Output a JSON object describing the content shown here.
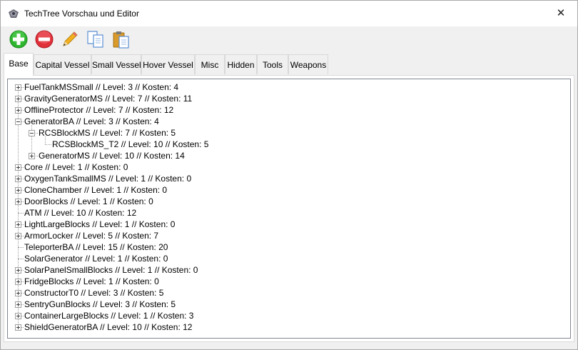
{
  "window": {
    "title": "TechTree Vorschau und Editor",
    "close_glyph": "✕"
  },
  "toolbar": {
    "buttons": [
      {
        "name": "add",
        "icon": "plus-circle-icon",
        "color": "#2db52d"
      },
      {
        "name": "remove",
        "icon": "minus-circle-icon",
        "color": "#e0303a"
      },
      {
        "name": "edit",
        "icon": "pencil-icon",
        "color": "#f2b01e"
      },
      {
        "name": "copy",
        "icon": "copy-icon",
        "color": "#5b8fd6"
      },
      {
        "name": "paste",
        "icon": "paste-icon",
        "color": "#d99a2b"
      }
    ]
  },
  "tabs": [
    {
      "label": "Base",
      "active": true
    },
    {
      "label": "Capital Vessel"
    },
    {
      "label": "Small Vessel"
    },
    {
      "label": "Hover Vessel"
    },
    {
      "label": "Misc"
    },
    {
      "label": "Hidden"
    },
    {
      "label": "Tools"
    },
    {
      "label": "Weapons"
    }
  ],
  "tree": {
    "nodes": [
      {
        "label": "FuelTankMSSmall // Level: 3 // Kosten: 4",
        "depth": 0,
        "expander": "plus"
      },
      {
        "label": "GravityGeneratorMS // Level: 7 // Kosten: 11",
        "depth": 0,
        "expander": "plus"
      },
      {
        "label": "OfflineProtector // Level: 7 // Kosten: 12",
        "depth": 0,
        "expander": "plus"
      },
      {
        "label": "GeneratorBA // Level: 3 // Kosten: 4",
        "depth": 0,
        "expander": "minus"
      },
      {
        "label": "RCSBlockMS // Level: 7 // Kosten: 5",
        "depth": 1,
        "expander": "minus"
      },
      {
        "label": "RCSBlockMS_T2 // Level: 10 // Kosten: 5",
        "depth": 2,
        "expander": "none"
      },
      {
        "label": "GeneratorMS // Level: 10 // Kosten: 14",
        "depth": 1,
        "expander": "plus"
      },
      {
        "label": "Core // Level: 1 // Kosten: 0",
        "depth": 0,
        "expander": "plus"
      },
      {
        "label": "OxygenTankSmallMS // Level: 1 // Kosten: 0",
        "depth": 0,
        "expander": "plus"
      },
      {
        "label": "CloneChamber // Level: 1 // Kosten: 0",
        "depth": 0,
        "expander": "plus"
      },
      {
        "label": "DoorBlocks // Level: 1 // Kosten: 0",
        "depth": 0,
        "expander": "plus"
      },
      {
        "label": "ATM // Level: 10 // Kosten: 12",
        "depth": 0,
        "expander": "none"
      },
      {
        "label": "LightLargeBlocks // Level: 1 // Kosten: 0",
        "depth": 0,
        "expander": "plus"
      },
      {
        "label": "ArmorLocker // Level: 5 // Kosten: 7",
        "depth": 0,
        "expander": "plus"
      },
      {
        "label": "TeleporterBA // Level: 15 // Kosten: 20",
        "depth": 0,
        "expander": "none"
      },
      {
        "label": "SolarGenerator // Level: 1 // Kosten: 0",
        "depth": 0,
        "expander": "none"
      },
      {
        "label": "SolarPanelSmallBlocks // Level: 1 // Kosten: 0",
        "depth": 0,
        "expander": "plus"
      },
      {
        "label": "FridgeBlocks // Level: 1 // Kosten: 0",
        "depth": 0,
        "expander": "plus"
      },
      {
        "label": "ConstructorT0 // Level: 3 // Kosten: 5",
        "depth": 0,
        "expander": "plus"
      },
      {
        "label": "SentryGunBlocks // Level: 3 // Kosten: 5",
        "depth": 0,
        "expander": "plus"
      },
      {
        "label": "ContainerLargeBlocks // Level: 1 // Kosten: 3",
        "depth": 0,
        "expander": "plus"
      },
      {
        "label": "ShieldGeneratorBA // Level: 10 // Kosten: 12",
        "depth": 0,
        "expander": "plus"
      }
    ]
  }
}
